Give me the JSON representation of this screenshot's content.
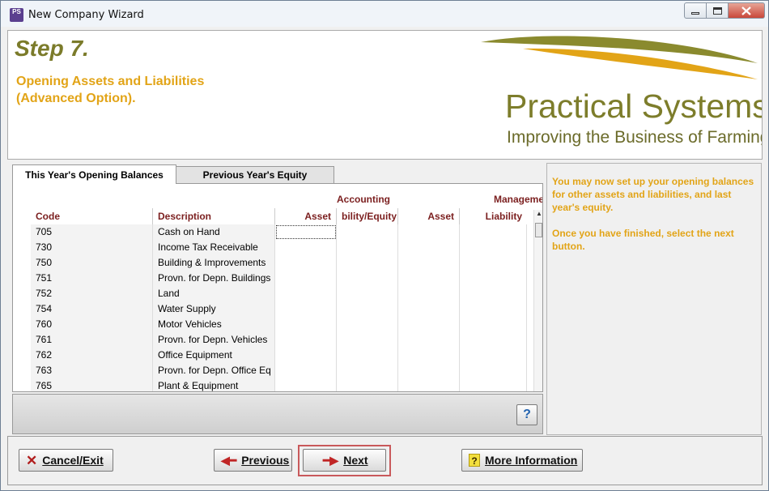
{
  "window": {
    "icon_label": "PS",
    "title": "New Company Wizard"
  },
  "header": {
    "step": "Step 7.",
    "subtitle_line1": "Opening Assets and Liabilities",
    "subtitle_line2": "(Advanced Option).",
    "logo_name": "Practical Systems",
    "logo_tagline": "Improving the Business of Farming"
  },
  "tabs": [
    {
      "label": "This Year's Opening Balances",
      "active": true
    },
    {
      "label": "Previous Year's Equity",
      "active": false
    }
  ],
  "grid": {
    "group_headers": {
      "accounting": "Accounting",
      "management": "Management"
    },
    "columns": [
      "Code",
      "Description",
      "Asset",
      "bility/Equity",
      "Asset",
      "Liability"
    ],
    "rows": [
      {
        "code": "705",
        "description": "Cash on Hand"
      },
      {
        "code": "730",
        "description": "Income Tax Receivable"
      },
      {
        "code": "750",
        "description": "Building & Improvements"
      },
      {
        "code": "751",
        "description": "Provn. for Depn. Buildings"
      },
      {
        "code": "752",
        "description": "Land"
      },
      {
        "code": "754",
        "description": "Water Supply"
      },
      {
        "code": "760",
        "description": "Motor Vehicles"
      },
      {
        "code": "761",
        "description": "Provn. for Depn. Vehicles"
      },
      {
        "code": "762",
        "description": "Office Equipment"
      },
      {
        "code": "763",
        "description": "Provn. for Depn. Office Eq"
      },
      {
        "code": "765",
        "description": "Plant & Equipment"
      }
    ]
  },
  "help_button": "?",
  "info": {
    "paragraph1": "You may now set up your opening balances for other assets and liabilities, and last year's equity.",
    "paragraph2": "Once you have finished, select the next button."
  },
  "buttons": {
    "cancel": "Cancel/Exit",
    "previous": "Previous",
    "next": "Next",
    "more_info": "More Information"
  },
  "colors": {
    "step_title": "#7b7b2a",
    "subtitle": "#e2a417",
    "header_text": "#7b1f1f",
    "highlight_border": "#c9595b"
  }
}
